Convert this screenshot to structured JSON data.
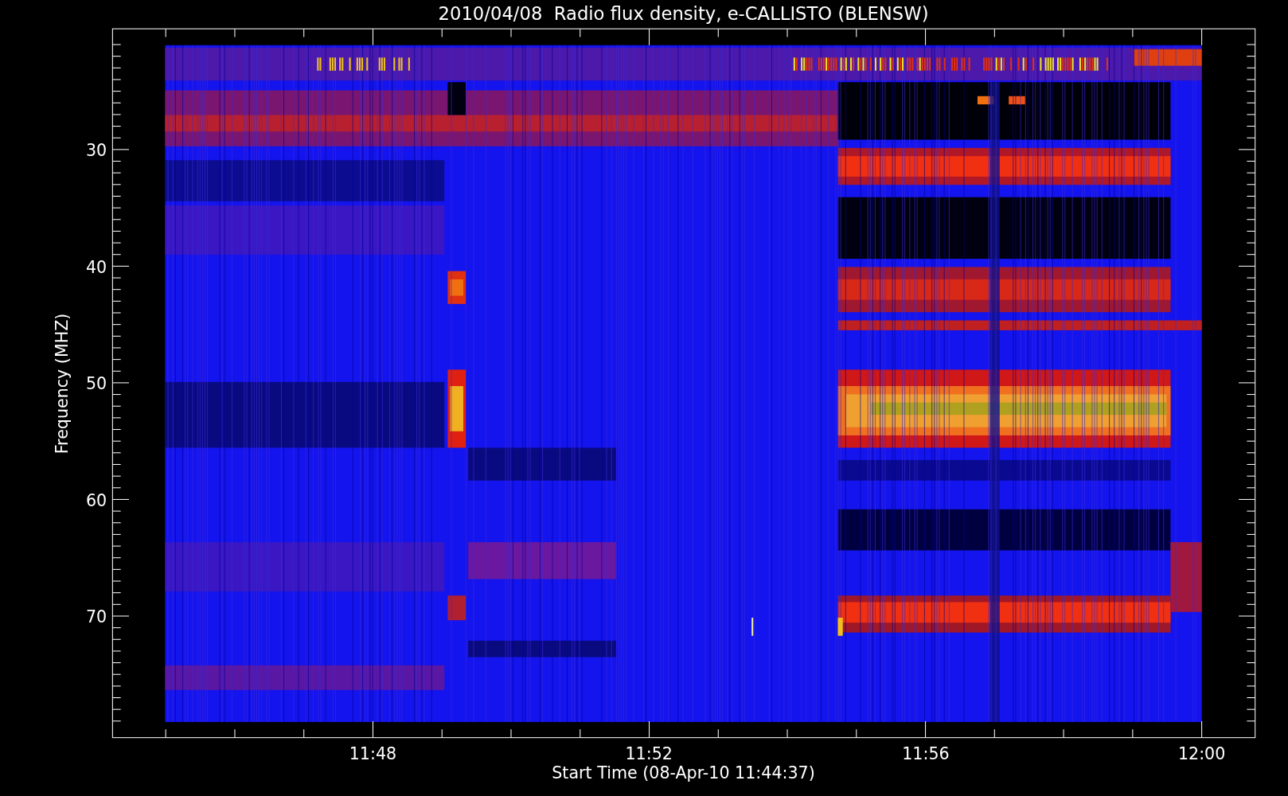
{
  "plot": {
    "title": "2010/04/08  Radio flux density, e-CALLISTO (BLENSW)",
    "ylabel": "Frequency (MHZ)",
    "xlabel": "Start Time (08-Apr-10 11:44:37)",
    "yticks": [
      "30",
      "40",
      "50",
      "60",
      "70"
    ],
    "xticks": [
      "11:48",
      "11:52",
      "11:56",
      "12:00"
    ]
  }
}
